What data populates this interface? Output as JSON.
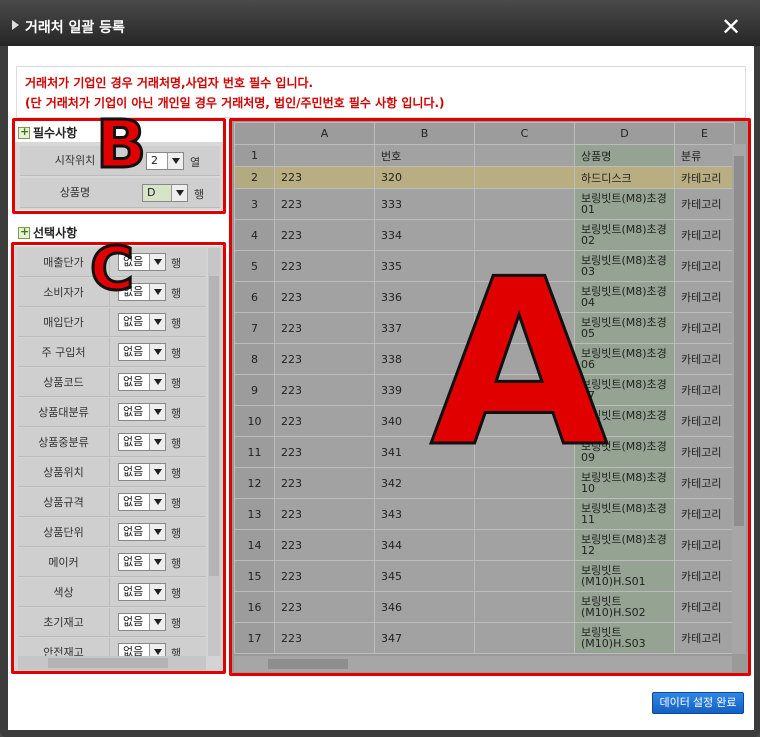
{
  "dialog": {
    "title": "거래처 일괄 등록",
    "close_label": "✕"
  },
  "notice": {
    "line1": "거래처가 기업인 경우 거래처명,사업자 번호 필수 입니다.",
    "line2": "(단 거래처가 기업이 아닌 개인일 경우 거래처명, 법인/주민번호 필수 사항 입니다.)"
  },
  "required": {
    "header": "필수사항",
    "start_label": "시작위치",
    "start_value": "2",
    "start_unit": "열",
    "product_label": "상품명",
    "product_value": "D",
    "product_unit": "행"
  },
  "optional": {
    "header": "선택사항",
    "rows": [
      {
        "label": "매출단가",
        "value": "없음",
        "unit": "행"
      },
      {
        "label": "소비자가",
        "value": "없음",
        "unit": "행"
      },
      {
        "label": "매입단가",
        "value": "없음",
        "unit": "행"
      },
      {
        "label": "주 구입처",
        "value": "없음",
        "unit": "행"
      },
      {
        "label": "상품코드",
        "value": "없음",
        "unit": "행"
      },
      {
        "label": "상품대분류",
        "value": "없음",
        "unit": "행"
      },
      {
        "label": "상품중분류",
        "value": "없음",
        "unit": "행"
      },
      {
        "label": "상품위치",
        "value": "없음",
        "unit": "행"
      },
      {
        "label": "상품규격",
        "value": "없음",
        "unit": "행"
      },
      {
        "label": "상품단위",
        "value": "없음",
        "unit": "행"
      },
      {
        "label": "메이커",
        "value": "없음",
        "unit": "행"
      },
      {
        "label": "색상",
        "value": "없음",
        "unit": "행"
      },
      {
        "label": "초기재고",
        "value": "없음",
        "unit": "행"
      },
      {
        "label": "안전재고",
        "value": "없음",
        "unit": "행"
      }
    ]
  },
  "grid": {
    "columns": [
      "A",
      "B",
      "C",
      "D",
      "E"
    ],
    "rows": [
      {
        "n": "1",
        "a": "",
        "b": "번호",
        "c": "",
        "d": "상품명",
        "e": "분류"
      },
      {
        "n": "2",
        "a": "223",
        "b": "320",
        "c": "",
        "d": "하드디스크",
        "e": "카테고리"
      },
      {
        "n": "3",
        "a": "223",
        "b": "333",
        "c": "",
        "d": "보링빗트(M8)초경01",
        "e": "카테고리"
      },
      {
        "n": "4",
        "a": "223",
        "b": "334",
        "c": "",
        "d": "보링빗트(M8)초경02",
        "e": "카테고리"
      },
      {
        "n": "5",
        "a": "223",
        "b": "335",
        "c": "",
        "d": "보링빗트(M8)초경03",
        "e": "카테고리"
      },
      {
        "n": "6",
        "a": "223",
        "b": "336",
        "c": "",
        "d": "보링빗트(M8)초경04",
        "e": "카테고리"
      },
      {
        "n": "7",
        "a": "223",
        "b": "337",
        "c": "",
        "d": "보링빗트(M8)초경05",
        "e": "카테고리"
      },
      {
        "n": "8",
        "a": "223",
        "b": "338",
        "c": "",
        "d": "보링빗트(M8)초경06",
        "e": "카테고리"
      },
      {
        "n": "9",
        "a": "223",
        "b": "339",
        "c": "",
        "d": "보링빗트(M8)초경07",
        "e": "카테고리"
      },
      {
        "n": "10",
        "a": "223",
        "b": "340",
        "c": "",
        "d": "보링빗트(M8)초경08",
        "e": "카테고리"
      },
      {
        "n": "11",
        "a": "223",
        "b": "341",
        "c": "",
        "d": "보링빗트(M8)초경09",
        "e": "카테고리"
      },
      {
        "n": "12",
        "a": "223",
        "b": "342",
        "c": "",
        "d": "보링빗트(M8)초경10",
        "e": "카테고리"
      },
      {
        "n": "13",
        "a": "223",
        "b": "343",
        "c": "",
        "d": "보링빗트(M8)초경11",
        "e": "카테고리"
      },
      {
        "n": "14",
        "a": "223",
        "b": "344",
        "c": "",
        "d": "보링빗트(M8)초경12",
        "e": "카테고리"
      },
      {
        "n": "15",
        "a": "223",
        "b": "345",
        "c": "",
        "d": "보링빗트(M10)H.S01",
        "e": "카테고리"
      },
      {
        "n": "16",
        "a": "223",
        "b": "346",
        "c": "",
        "d": "보링빗트(M10)H.S02",
        "e": "카테고리"
      },
      {
        "n": "17",
        "a": "223",
        "b": "347",
        "c": "",
        "d": "보링빗트(M10)H.S03",
        "e": "카테고리"
      }
    ]
  },
  "annotations": {
    "a": "A",
    "b": "B",
    "c": "C"
  },
  "footer": {
    "confirm_label": "데이터 설정 완료"
  }
}
